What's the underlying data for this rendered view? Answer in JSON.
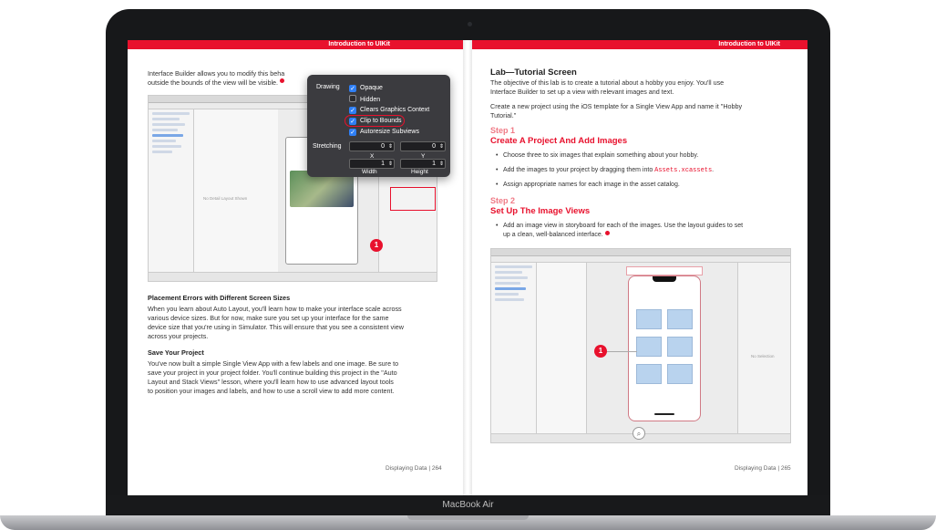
{
  "device": {
    "brand_label": "MacBook Air"
  },
  "header": {
    "left_title": "Introduction to UIKit",
    "right_title": "Introduction to UIKit"
  },
  "left_page": {
    "intro_line1": "Interface Builder allows you to modify this beha",
    "intro_line2": "outside the bounds of the view will be visible.",
    "inspector": {
      "drawing_label": "Drawing",
      "options": [
        "Opaque",
        "Hidden",
        "Clears Graphics Context",
        "Clip to Bounds",
        "Autoresize Subviews"
      ],
      "checked": [
        true,
        false,
        true,
        true,
        true
      ],
      "stretching_label": "Stretching",
      "x_value": "0",
      "y_value": "0",
      "x_label": "X",
      "y_label": "Y",
      "width_value": "1",
      "height_value": "1",
      "width_label": "Width",
      "height_label": "Height"
    },
    "callout_number": "1",
    "placeholder_text": "No Detail Layout Shown",
    "placement_heading": "Placement Errors with Different Screen Sizes",
    "placement_body": [
      "When you learn about Auto Layout, you'll learn how to make your interface scale across",
      "various device sizes. But for now, make sure you set up your interface for the same",
      "device size that you're using in Simulator. This will ensure that you see a consistent view",
      "across your projects."
    ],
    "save_heading": "Save Your Project",
    "save_body": [
      "You've now built a simple Single View App with a few labels and one image. Be sure to",
      "save your project in your project folder. You'll continue building this project in the \"Auto",
      "Layout and Stack Views\" lesson, where you'll learn how to use advanced layout tools",
      "to position your images and labels, and how to use a scroll view to add more content."
    ],
    "footer": "Displaying Data  |  264"
  },
  "right_page": {
    "lab_heading": "Lab—Tutorial Screen",
    "lab_body": [
      "The objective of this lab is to create a tutorial about a hobby you enjoy. You'll use",
      "Interface Builder to set up a view with relevant images and text."
    ],
    "new_project": [
      "Create a new project using the iOS template for a Single View App and name it \"Hobby",
      "Tutorial.\""
    ],
    "step1_label": "Step 1",
    "step1_title": "Create A Project And Add Images",
    "step1_bullets": [
      "Choose three to six images that explain something about your hobby.",
      "Add the images to your project by dragging them into ",
      "Assign appropriate names for each image in the asset catalog."
    ],
    "assets_code": "Assets.xcassets",
    "step2_label": "Step 2",
    "step2_title": "Set Up The Image Views",
    "step2_bullet": [
      "Add an image view in storyboard for each of the images. Use the layout guides to set",
      "up a clean, well-balanced interface."
    ],
    "callout_number": "1",
    "no_selection": "No Selection",
    "footer": "Displaying Data  |  265"
  },
  "colors": {
    "accent": "#e8112d",
    "checkbox": "#2f7ff5",
    "tile": "#b9d3ee"
  }
}
